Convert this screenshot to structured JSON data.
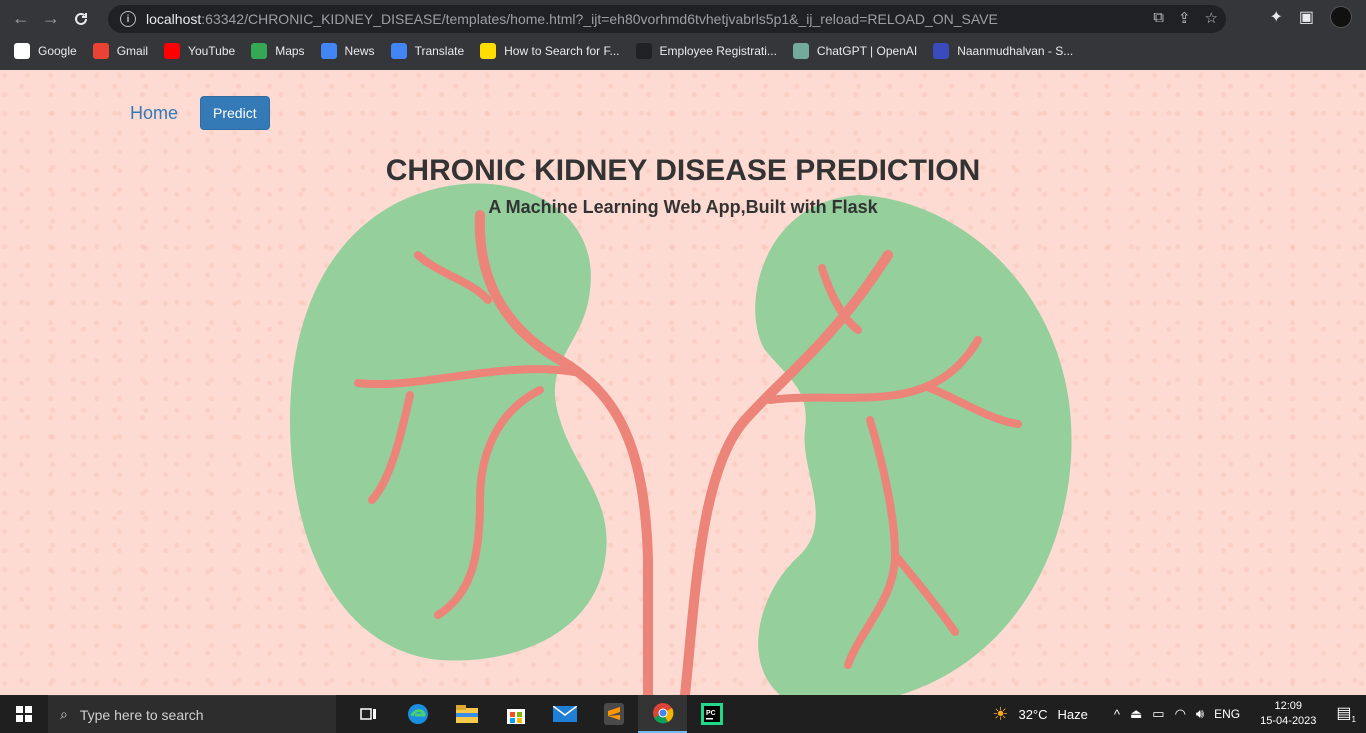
{
  "browser": {
    "url_host": "localhost",
    "url_rest": ":63342/CHRONIC_KIDNEY_DISEASE/templates/home.html?_ijt=eh80vorhmd6tvhetjvabrls5p1&_ij_reload=RELOAD_ON_SAVE",
    "bookmarks": [
      {
        "label": "Google",
        "icon": "google-icon",
        "color": "#ffffff"
      },
      {
        "label": "Gmail",
        "icon": "gmail-icon",
        "color": "#ea4335"
      },
      {
        "label": "YouTube",
        "icon": "youtube-icon",
        "color": "#ff0000"
      },
      {
        "label": "Maps",
        "icon": "maps-icon",
        "color": "#34a853"
      },
      {
        "label": "News",
        "icon": "news-icon",
        "color": "#4285f4"
      },
      {
        "label": "Translate",
        "icon": "translate-icon",
        "color": "#4285f4"
      },
      {
        "label": "How to Search for F...",
        "icon": "d-icon",
        "color": "#ffdd00"
      },
      {
        "label": "Employee Registrati...",
        "icon": "dot-icon",
        "color": "#202124"
      },
      {
        "label": "ChatGPT | OpenAI",
        "icon": "openai-icon",
        "color": "#74aa9c"
      },
      {
        "label": "Naanmudhalvan - S...",
        "icon": "naan-icon",
        "color": "#3b4bbd"
      }
    ]
  },
  "page": {
    "nav_home": "Home",
    "nav_predict": "Predict",
    "title": "CHRONIC KIDNEY DISEASE PREDICTION",
    "subtitle": "A Machine Learning Web App,Built with Flask",
    "colors": {
      "background": "#fddbd2",
      "kidney": "#94cf9c",
      "vessel": "#ec8479",
      "button": "#337ab7"
    }
  },
  "taskbar": {
    "search_placeholder": "Type here to search",
    "weather_temp": "32°C",
    "weather_desc": "Haze",
    "language": "ENG",
    "time": "12:09",
    "date": "15-04-2023",
    "notification_count": "1"
  }
}
